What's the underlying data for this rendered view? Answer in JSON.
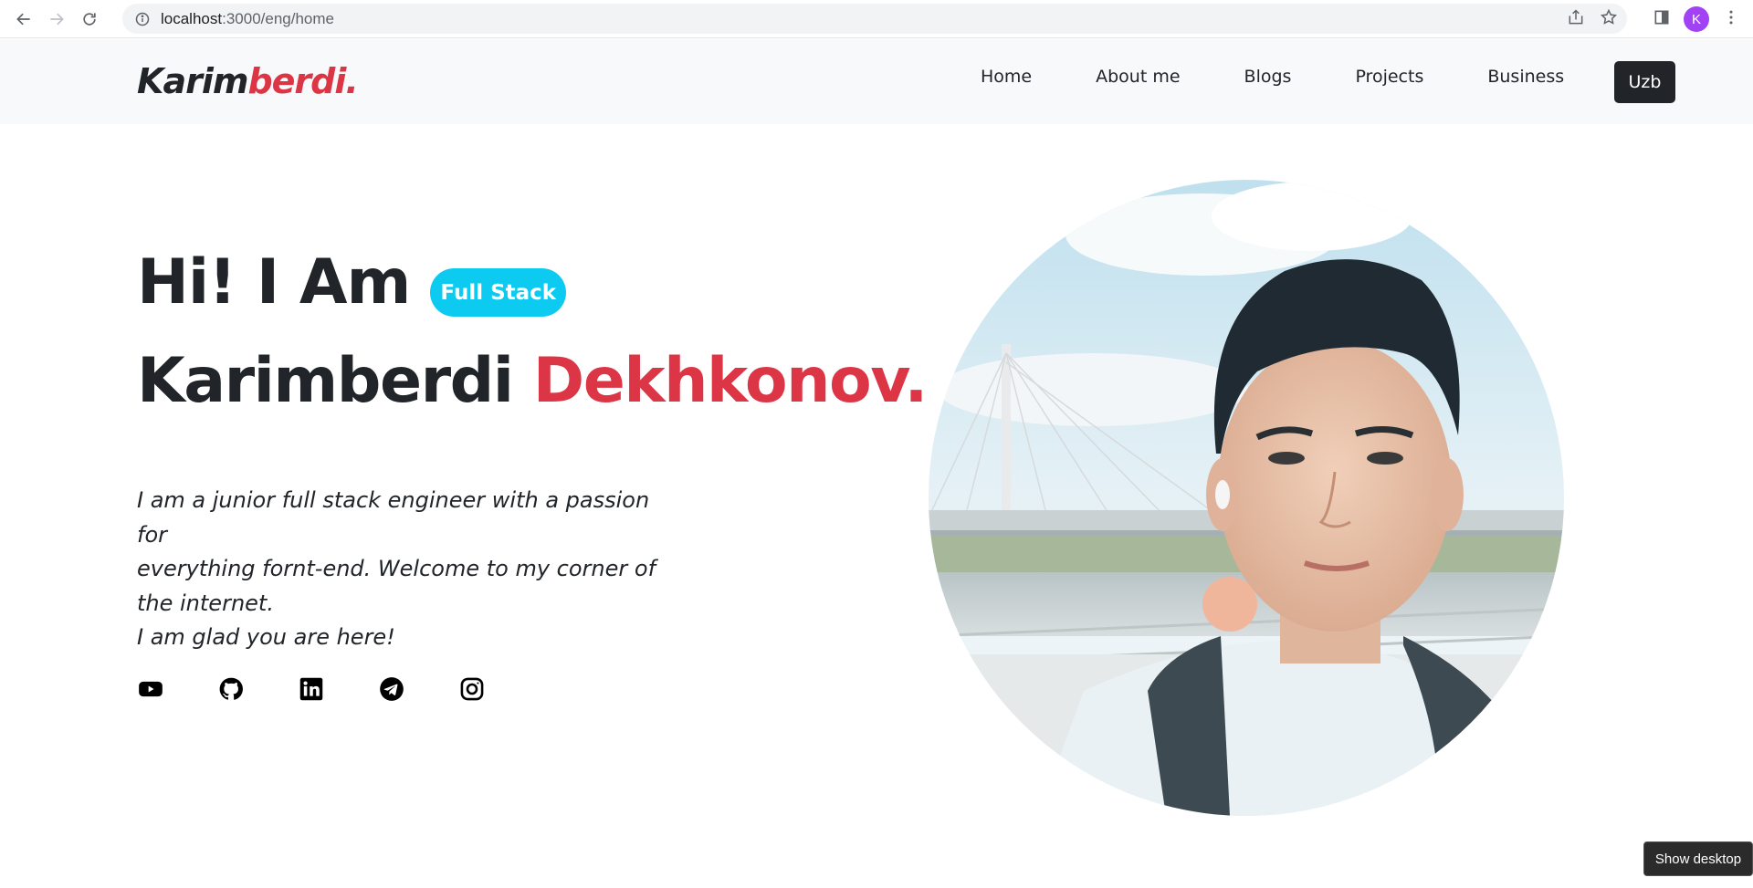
{
  "browser": {
    "url_host": "localhost",
    "url_path": ":3000/eng/home",
    "profile_initial": "K",
    "icons": [
      "back-icon",
      "forward-icon",
      "reload-icon",
      "info-icon",
      "share-icon",
      "bookmark-star-icon",
      "side-panel-icon",
      "menu-icon"
    ]
  },
  "navbar": {
    "brand_part1": "Karim",
    "brand_part2": "berdi.",
    "links": [
      "Home",
      "About me",
      "Blogs",
      "Projects",
      "Business"
    ],
    "lang_button": "Uzb"
  },
  "hero": {
    "greeting": "Hi! I Am",
    "role_badge": "Full Stack",
    "first_name": "Karimberdi",
    "last_name": "Dekhkonov.",
    "intro_lines": [
      "I am a junior full stack engineer with a passion for",
      "everything fornt-end. Welcome to my corner of",
      "the internet.",
      "I am glad you are here!"
    ],
    "social_icons": [
      "youtube-icon",
      "github-icon",
      "linkedin-icon",
      "telegram-icon",
      "instagram-icon"
    ]
  },
  "tooltip": "Show desktop",
  "colors": {
    "accent_red": "#dc3545",
    "badge_cyan": "#0dcaf0",
    "dark": "#212529",
    "navbar_bg": "#f8f9fa"
  }
}
